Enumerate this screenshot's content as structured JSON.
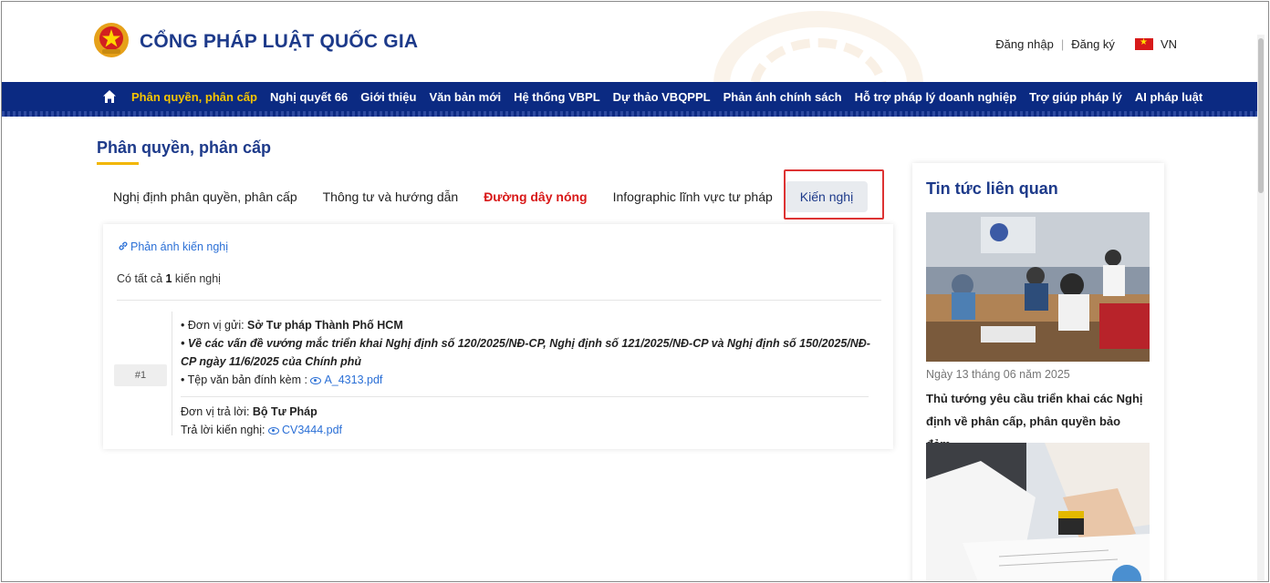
{
  "header": {
    "site_title": "CỔNG PHÁP LUẬT QUỐC GIA",
    "login": "Đăng nhập",
    "separator": "|",
    "register": "Đăng ký",
    "language": "VN"
  },
  "nav": {
    "items": [
      "Phân quyền, phân cấp",
      "Nghị quyết 66",
      "Giới thiệu",
      "Văn bản mới",
      "Hệ thống VBPL",
      "Dự thảo VBQPPL",
      "Phản ánh chính sách",
      "Hỗ trợ pháp lý doanh nghiệp",
      "Trợ giúp pháp lý",
      "AI pháp luật"
    ],
    "active_index": 0
  },
  "page": {
    "title": "Phân quyền, phân cấp"
  },
  "tabs": [
    "Nghị định phân quyền, phân cấp",
    "Thông tư và hướng dẫn",
    "Đường dây nóng",
    "Infographic lĩnh vực tư pháp",
    "Kiến nghị"
  ],
  "content": {
    "reflect_link": "Phản ánh kiến nghị",
    "count_prefix": "Có tất cả ",
    "count_value": "1",
    "count_suffix": " kiến nghị",
    "item": {
      "number": "#1",
      "sender_label": "• Đơn vị gửi: ",
      "sender_value": "Sở Tư pháp Thành Phố HCM",
      "subject": "• Về các vấn đề vướng mắc triển khai Nghị định số 120/2025/NĐ-CP, Nghị định số 121/2025/NĐ-CP và Nghị định số 150/2025/NĐ-CP ngày 11/6/2025 của Chính phủ",
      "attachment_label": "• Tệp văn bản đính kèm : ",
      "attachment_file": "A_4313.pdf",
      "responder_label": "Đơn vị trả lời: ",
      "responder_value": "Bộ Tư Pháp",
      "reply_label": "Trả lời kiến nghị: ",
      "reply_file": "CV3444.pdf"
    }
  },
  "sidebar": {
    "title": "Tin tức liên quan",
    "news": [
      {
        "date": "Ngày 13 tháng 06 năm 2025",
        "title": "Thủ tướng yêu cầu triển khai các Nghị định về phân cấp, phân quyền bảo đảm..."
      }
    ]
  },
  "colors": {
    "brand_blue": "#1d3a8a",
    "nav_bg": "#0b2a82",
    "nav_active": "#f6c500",
    "hotline_red": "#d81818",
    "link_blue": "#2a6fd6",
    "highlight_red": "#dd3333"
  }
}
